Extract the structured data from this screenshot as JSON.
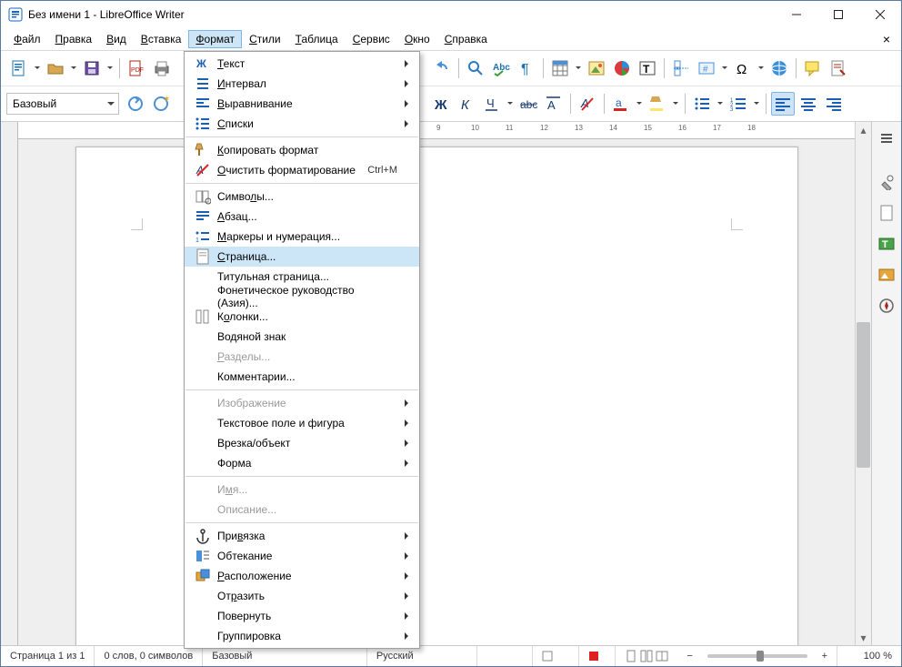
{
  "title": "Без имени 1 - LibreOffice Writer",
  "menubar": [
    "Файл",
    "Правка",
    "Вид",
    "Вставка",
    "Формат",
    "Стили",
    "Таблица",
    "Сервис",
    "Окно",
    "Справка"
  ],
  "menubar_open_index": 4,
  "style_combo": "Базовый",
  "ruler_labels": [
    9,
    10,
    11,
    12,
    13,
    14,
    15,
    16,
    17,
    18
  ],
  "statusbar": {
    "page": "Страница 1 из 1",
    "words": "0 слов, 0 символов",
    "style": "Базовый",
    "lang": "Русский",
    "zoom": "100 %"
  },
  "dropdown": {
    "groups": [
      [
        {
          "icon": "char",
          "label": "Текст",
          "u": 0,
          "sub": true
        },
        {
          "icon": "spacing",
          "label": "Интервал",
          "u": 0,
          "sub": true
        },
        {
          "icon": "align",
          "label": "Выравнивание",
          "u": 0,
          "sub": true
        },
        {
          "icon": "list",
          "label": "Списки",
          "u": 0,
          "sub": true
        }
      ],
      [
        {
          "icon": "brush",
          "label": "Копировать формат",
          "u": 0
        },
        {
          "icon": "clear",
          "label": "Очистить форматирование",
          "u": 0,
          "shortcut": "Ctrl+M"
        }
      ],
      [
        {
          "icon": "symbol",
          "label": "Символы...",
          "u": 5
        },
        {
          "icon": "para",
          "label": "Абзац...",
          "u": 0
        },
        {
          "icon": "bullets",
          "label": "Маркеры и нумерация...",
          "u": 0
        },
        {
          "icon": "page",
          "label": "Страница...",
          "u": 0,
          "hl": true
        },
        {
          "icon": "",
          "label": "Титульная страница...",
          "u": -1
        },
        {
          "icon": "",
          "label": "Фонетическое руководство (Азия)...",
          "u": -1
        },
        {
          "icon": "columns",
          "label": "Колонки...",
          "u": 1
        },
        {
          "icon": "",
          "label": "Водяной знак",
          "u": -1
        },
        {
          "icon": "",
          "label": "Разделы...",
          "u": 0,
          "disabled": true
        },
        {
          "icon": "",
          "label": "Комментарии...",
          "u": -1
        }
      ],
      [
        {
          "icon": "",
          "label": "Изображение",
          "u": -1,
          "sub": true,
          "disabled": true
        },
        {
          "icon": "",
          "label": "Текстовое поле и фигура",
          "u": -1,
          "sub": true
        },
        {
          "icon": "",
          "label": "Врезка/объект",
          "u": -1,
          "sub": true
        },
        {
          "icon": "",
          "label": "Форма",
          "u": -1,
          "sub": true
        }
      ],
      [
        {
          "icon": "",
          "label": "Имя...",
          "u": 1,
          "disabled": true
        },
        {
          "icon": "",
          "label": "Описание...",
          "u": -1,
          "disabled": true
        }
      ],
      [
        {
          "icon": "anchor",
          "label": "Привязка",
          "u": 3,
          "sub": true
        },
        {
          "icon": "wrap",
          "label": "Обтекание",
          "u": -1,
          "sub": true
        },
        {
          "icon": "arrange",
          "label": "Расположение",
          "u": 0,
          "sub": true
        },
        {
          "icon": "",
          "label": "Отразить",
          "u": 2,
          "sub": true
        },
        {
          "icon": "",
          "label": "Повернуть",
          "u": -1,
          "sub": true
        },
        {
          "icon": "",
          "label": "Группировка",
          "u": -1,
          "sub": true
        }
      ]
    ]
  }
}
